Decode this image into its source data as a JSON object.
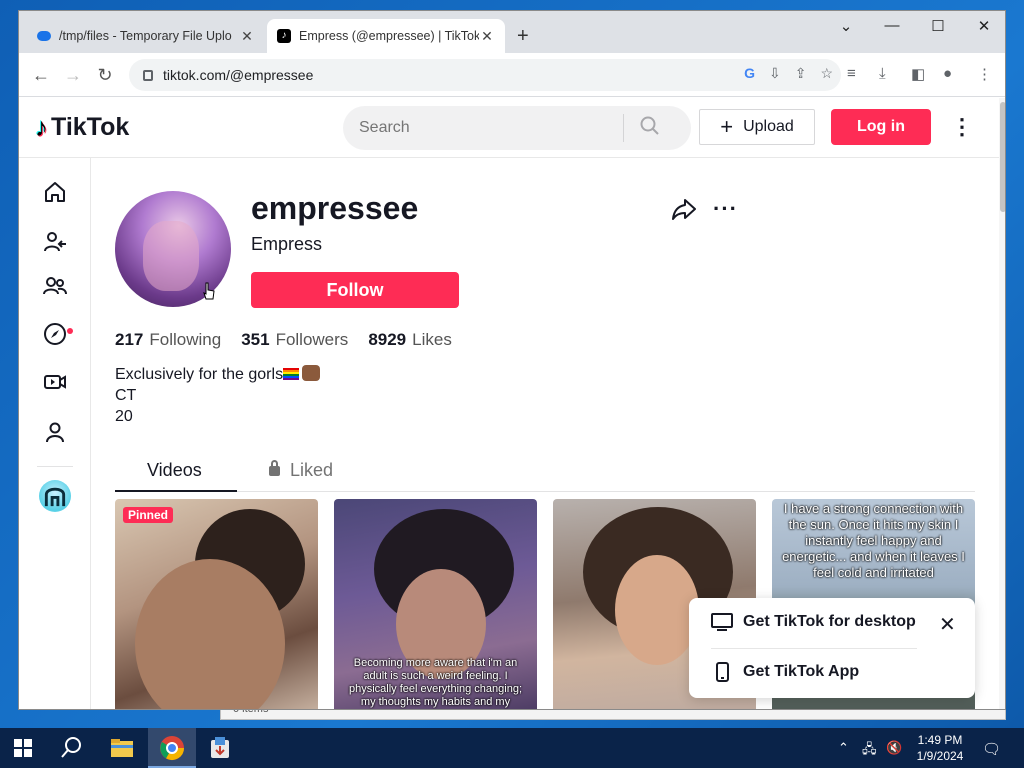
{
  "browser": {
    "tabs": [
      {
        "title": "/tmp/files - Temporary File Uplo",
        "icon": "cloud-upload-icon",
        "active": false
      },
      {
        "title": "Empress (@empressee) | TikTok",
        "icon": "tiktok-icon",
        "active": true
      }
    ],
    "url": "tiktok.com/@empressee"
  },
  "tiktok": {
    "logo": "TikTok",
    "search_placeholder": "Search",
    "upload_label": "Upload",
    "login_label": "Log in"
  },
  "profile": {
    "username": "empressee",
    "nickname": "Empress",
    "follow_label": "Follow",
    "stats": [
      {
        "value": "217",
        "label": "Following"
      },
      {
        "value": "351",
        "label": "Followers"
      },
      {
        "value": "8929",
        "label": "Likes"
      }
    ],
    "bio_line1": "Exclusively for the gorls",
    "bio_line2": "CT",
    "bio_line3": "20",
    "tab_videos": "Videos",
    "tab_liked": "Liked"
  },
  "videos": [
    {
      "badge": "Pinned",
      "caption": ""
    },
    {
      "badge": "",
      "caption": "Becoming more aware that i'm an adult is such a weird feeling. I physically feel everything changing; my thoughts my habits and my"
    },
    {
      "badge": "",
      "caption": ""
    },
    {
      "badge": "",
      "caption": "I have a strong connection with the sun. Once it hits my skin I instantly feel happy and energetic... and when it leaves I feel cold and irritated"
    }
  ],
  "popup": {
    "desktop_label": "Get TikTok for desktop",
    "app_label": "Get TikTok App"
  },
  "background_window": {
    "status": "0 items"
  },
  "taskbar": {
    "time": "1:49 PM",
    "date": "1/9/2024"
  },
  "colors": {
    "accent": "#fe2c55",
    "taskbar": "#0a2349",
    "desktop": "#1a78d0"
  }
}
